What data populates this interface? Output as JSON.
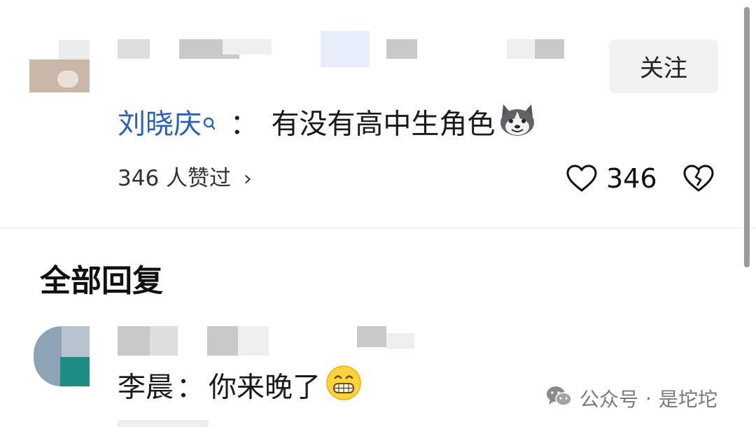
{
  "comment": {
    "follow_label": "关注",
    "mention_name": "刘晓庆",
    "separator": "：",
    "text": "有没有高中生角色",
    "liked_by": "346 人赞过",
    "liked_by_chevron": "›",
    "like_count": "346",
    "emoji_icon": "husky-emoji-icon",
    "like_icon": "heart-outline-icon",
    "dislike_icon": "broken-heart-icon"
  },
  "replies_header": "全部回复",
  "reply": {
    "name": "李晨",
    "separator": "：",
    "text": "你来晚了",
    "emoji_icon": "grinning-emoji-icon"
  },
  "watermark": {
    "prefix": "公众号",
    "dot": "·",
    "name": "是坨坨",
    "icon": "wechat-icon"
  },
  "colors": {
    "mention": "#2b62b7",
    "follow_button_bg": "#f2f2f2",
    "watermark": "#7a7a7a"
  }
}
